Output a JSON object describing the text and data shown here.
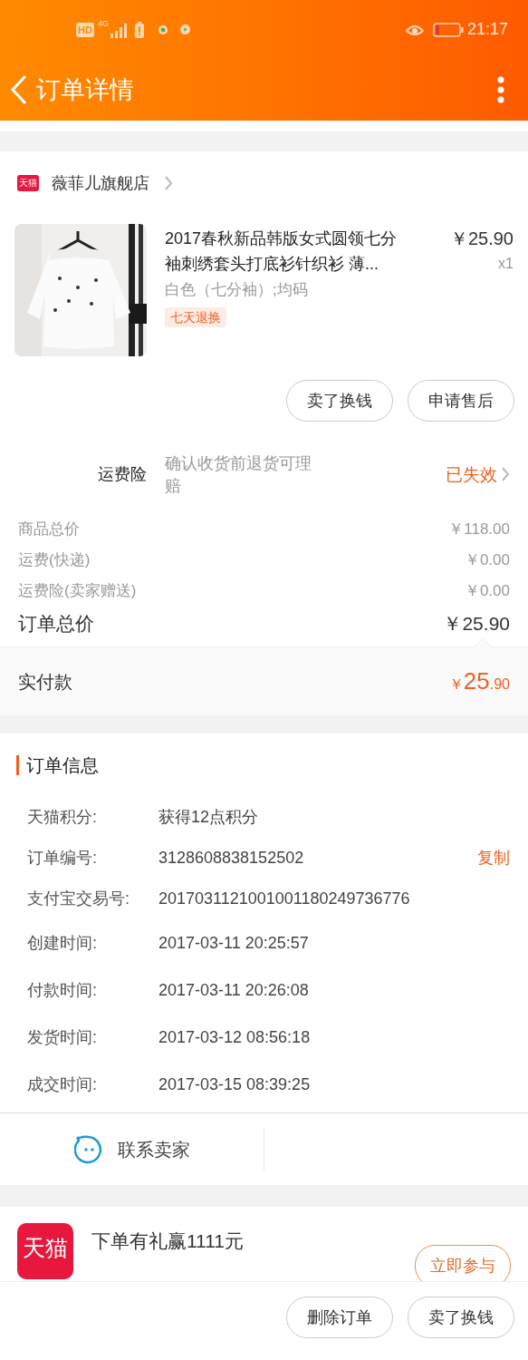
{
  "status_bar": {
    "hd": "HD",
    "network": "4G",
    "time": "21:17"
  },
  "header": {
    "title": "订单详情"
  },
  "shop": {
    "badge": "天猫",
    "name": "薇菲儿旗舰店"
  },
  "product": {
    "title": "2017春秋新品韩版女式圆领七分袖刺绣套头打底衫针织衫 薄...",
    "price": "￥25.90",
    "quantity": "x1",
    "spec": "白色（七分袖）;均码",
    "tag": "七天退换"
  },
  "product_buttons": [
    "卖了换钱",
    "申请售后"
  ],
  "freight_insurance": {
    "label": "运费险",
    "description": "确认收货前退货可理赔",
    "status": "已失效"
  },
  "price_lines": [
    {
      "kind": "minor",
      "label": "商品总价",
      "value": "￥118.00"
    },
    {
      "kind": "minor",
      "label": "运费(快递)",
      "value": "￥0.00"
    },
    {
      "kind": "minor",
      "label": "运费险(卖家赠送)",
      "value": "￥0.00"
    },
    {
      "kind": "major",
      "label": "订单总价",
      "value": "￥25.90"
    }
  ],
  "paid": {
    "label": "实付款",
    "currency": "￥",
    "integer": "25",
    "decimal": ".90"
  },
  "order_info": {
    "title": "订单信息",
    "rows": [
      {
        "label": "天猫积分:",
        "value": "获得12点积分"
      },
      {
        "label": "订单编号:",
        "value": "3128608838152502",
        "action": "复制"
      },
      {
        "label": "支付宝交易号:",
        "value": "2017031121001001180249736776"
      },
      {
        "label": "创建时间:",
        "value": "2017-03-11 20:25:57"
      },
      {
        "label": "付款时间:",
        "value": "2017-03-11 20:26:08"
      },
      {
        "label": "发货时间:",
        "value": "2017-03-12 08:56:18"
      },
      {
        "label": "成交时间:",
        "value": "2017-03-15 08:39:25"
      }
    ]
  },
  "contact": {
    "label": "联系卖家"
  },
  "promo": {
    "logo": "天猫",
    "text": "下单有礼赢1111元",
    "button": "立即参与"
  },
  "bottom_buttons": [
    "删除订单",
    "卖了换钱"
  ]
}
